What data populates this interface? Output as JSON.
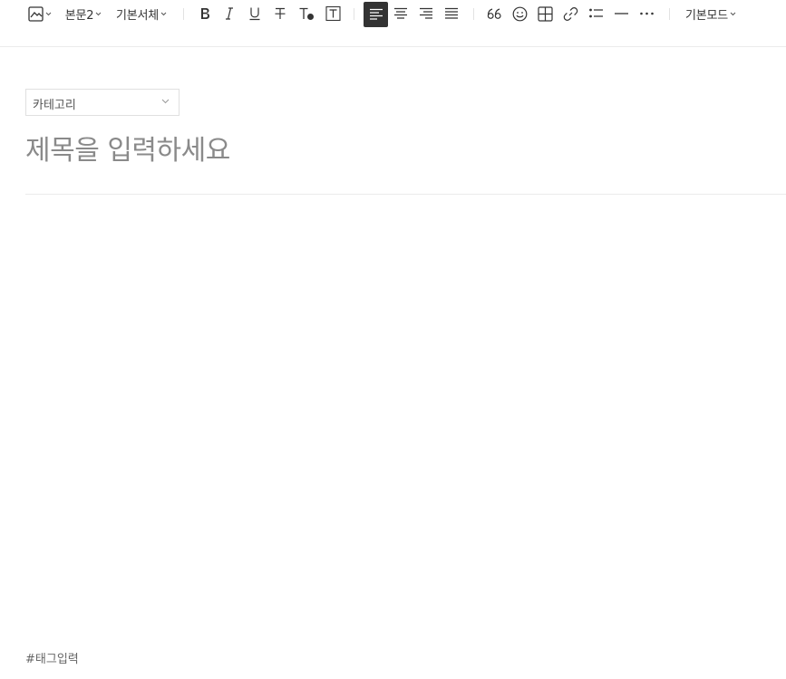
{
  "toolbar": {
    "image_icon": "image-icon",
    "paragraph_style": "본문2",
    "font_family": "기본서체",
    "format_buttons": [
      "bold-icon",
      "italic-icon",
      "underline-icon",
      "strikethrough-icon",
      "text-color-icon",
      "text-background-icon"
    ],
    "align_buttons": [
      "align-left-icon",
      "align-center-icon",
      "align-right-icon",
      "align-justify-icon"
    ],
    "active_align": "align-left",
    "insert_buttons": [
      "quote-icon",
      "emoji-icon",
      "table-icon",
      "link-icon",
      "list-icon",
      "horizontal-line-icon",
      "more-icon"
    ],
    "mode": "기본모드"
  },
  "category": {
    "label": "카테고리"
  },
  "title": {
    "placeholder": "제목을 입력하세요"
  },
  "tags": {
    "placeholder": "#태그입력"
  },
  "colors": {
    "accent_active": "#333333",
    "divider": "#ebebeb",
    "placeholder": "#8a8a8a"
  }
}
